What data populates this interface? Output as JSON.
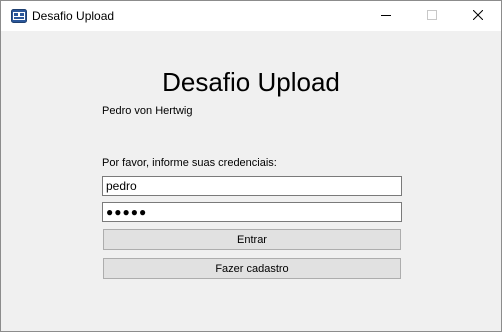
{
  "window": {
    "title": "Desafio Upload",
    "icons": {
      "app": "app-window-icon",
      "minimize": "minimize-icon",
      "maximize": "maximize-icon",
      "close": "close-icon"
    }
  },
  "form": {
    "heading": "Desafio Upload",
    "author": "Pedro von Hertwig",
    "prompt": "Por favor, informe suas credenciais:",
    "username_value": "pedro",
    "password_value": "●●●●●",
    "login_label": "Entrar",
    "register_label": "Fazer cadastro"
  },
  "colors": {
    "background": "#f0f0f0",
    "titlebar": "#ffffff",
    "button_face": "#e1e1e1",
    "button_border": "#adadad"
  }
}
